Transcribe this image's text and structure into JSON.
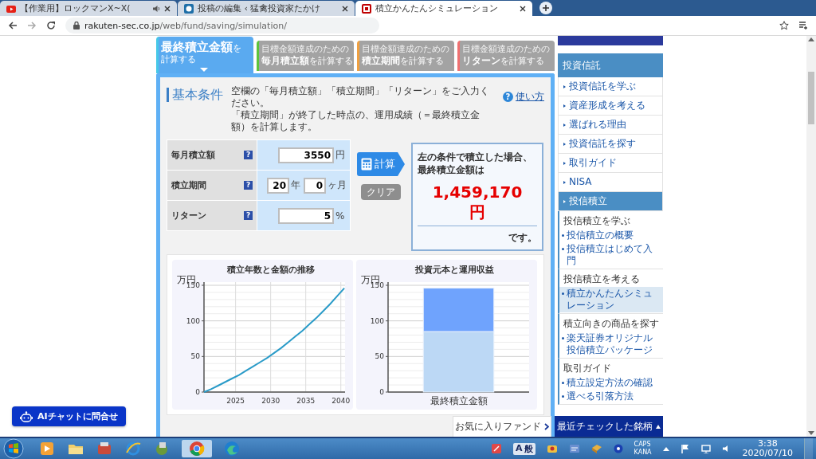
{
  "browser": {
    "tabs": [
      {
        "title": "【作業用】ロックマンX~X(",
        "audio": true,
        "selected": false
      },
      {
        "title": "投稿の編集 ‹ 猛禽投資家たかけ",
        "audio": false,
        "selected": false
      },
      {
        "title": "積立かんたんシミュレーション",
        "audio": false,
        "selected": true
      }
    ],
    "url_host": "rakuten-sec.co.jp",
    "url_path": "/web/fund/saving/simulation/"
  },
  "calc_tabs": [
    {
      "main": "最終積立金額",
      "tail": "を",
      "line2": "計算する",
      "color": "#46c8e8",
      "selected": true
    },
    {
      "lead": "目標金額達成のための",
      "main": "毎月積立額",
      "tail": "を計算する",
      "color": "#5cc33c",
      "selected": false
    },
    {
      "lead": "目標金額達成のための",
      "main": "積立期間",
      "tail": "を計算する",
      "color": "#f0a040",
      "selected": false
    },
    {
      "lead": "目標金額達成のための",
      "main": "リターン",
      "tail": "を計算する",
      "color": "#f07070",
      "selected": false
    }
  ],
  "conditions": {
    "title": "基本条件",
    "description": [
      "空欄の「毎月積立額」「積立期間」「リターン」をご入力ください。",
      "「積立期間」が終了した時点の、運用成績（＝最終積立金額）を計算します。"
    ],
    "help_icon": "?",
    "help_link": "使い方",
    "rows": [
      {
        "label": "毎月積立額",
        "help": "?",
        "inputs": [
          {
            "value": "3550",
            "unit": "円"
          }
        ]
      },
      {
        "label": "積立期間",
        "help": "?",
        "inputs": [
          {
            "value": "20",
            "unit": "年"
          },
          {
            "value": "0",
            "unit": "ヶ月"
          }
        ]
      },
      {
        "label": "リターン",
        "help": "?",
        "inputs": [
          {
            "value": "5",
            "unit": "%"
          }
        ]
      }
    ],
    "calc_button": "計算",
    "clear_button": "クリア",
    "result": {
      "lines": [
        "左の条件で積立した場合、",
        "最終積立金額は"
      ],
      "amount": "1,459,170",
      "unit": "円",
      "suffix": "です。"
    }
  },
  "charts": [
    {
      "chart_data": {
        "type": "line",
        "title": "積立年数と金額の推移",
        "ylabel": "万円",
        "grid": true,
        "xlim": [
          2020.5,
          2040.6
        ],
        "ylim": [
          0,
          150
        ],
        "xticks": [
          2025,
          2030,
          2035,
          2040
        ],
        "yticks": [
          0,
          50,
          100,
          150
        ],
        "x": [
          2020.5,
          2021.5,
          2022.5,
          2023.5,
          2024.5,
          2025.5,
          2026.5,
          2027.5,
          2028.5,
          2029.5,
          2030.5,
          2031.5,
          2032.5,
          2033.5,
          2034.5,
          2035.5,
          2036.5,
          2037.5,
          2038.5,
          2039.5,
          2040.5
        ],
        "series": [
          {
            "color": "#2a9bc8",
            "values": [
              0,
              4,
              9,
              14,
              19,
              24,
              30,
              36,
              42,
              48,
              55,
              62,
              70,
              78,
              86,
              95,
              104,
              114,
              124,
              135,
              146
            ]
          }
        ]
      }
    },
    {
      "chart_data": {
        "type": "bar",
        "title": "投資元本と運用収益",
        "ylabel": "万円",
        "grid": true,
        "ylim": [
          0,
          150
        ],
        "yticks": [
          0,
          50,
          100,
          150
        ],
        "stacked": true,
        "categories": [
          "最終積立金額"
        ],
        "series": [
          {
            "color": "#bcd8f5",
            "values": [
              85
            ]
          },
          {
            "color": "#6fa3fd",
            "values": [
              61
            ]
          }
        ]
      }
    }
  ],
  "sidebar": {
    "header": "投資信託",
    "items": [
      {
        "label": "投資信託を学ぶ",
        "selected": false
      },
      {
        "label": "資産形成を考える",
        "selected": false
      },
      {
        "label": "選ばれる理由",
        "selected": false
      },
      {
        "label": "投資信託を探す",
        "selected": false
      },
      {
        "label": "取引ガイド",
        "selected": false
      },
      {
        "label": "NISA",
        "selected": false
      },
      {
        "label": "投信積立",
        "selected": true,
        "groups": [
          {
            "heading": "投信積立を学ぶ",
            "links": [
              {
                "label": "投信積立の概要",
                "selected": false
              },
              {
                "label": "投信積立はじめて入門",
                "selected": false
              }
            ]
          },
          {
            "heading": "投信積立を考える",
            "links": [
              {
                "label": "積立かんたんシミュレーション",
                "selected": true
              }
            ]
          },
          {
            "heading": "積立向きの商品を探す",
            "links": [
              {
                "label": "楽天証券オリジナル投信積立パッケージ",
                "selected": false
              }
            ]
          },
          {
            "heading": "取引ガイド",
            "links": [
              {
                "label": "積立設定方法の確認",
                "selected": false
              },
              {
                "label": "選べる引落方法",
                "selected": false
              }
            ]
          }
        ]
      }
    ]
  },
  "ai_chat": "AIチャットに問合せ",
  "dock": {
    "favorites": "お気に入りファンド",
    "recent": "最近チェックした銘柄"
  },
  "taskbar": {
    "ime": [
      "A",
      "般"
    ],
    "caps": "CAPS",
    "kana": "KANA",
    "time": "3:38",
    "date": "2020/07/10"
  }
}
